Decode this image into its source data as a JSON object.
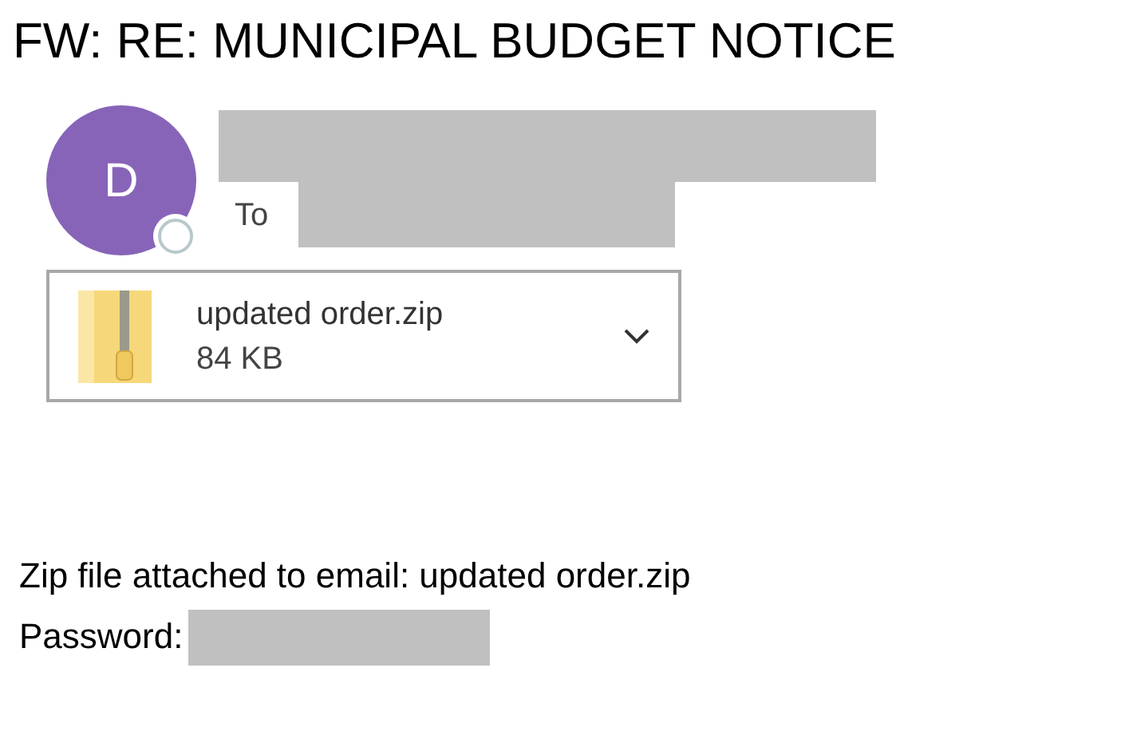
{
  "subject": "FW: RE: MUNICIPAL BUDGET NOTICE",
  "sender": {
    "avatar_initial": "D"
  },
  "recipients_label": "To",
  "attachment": {
    "name": "updated order.zip",
    "size": "84 KB"
  },
  "body": {
    "line": "Zip file attached to email: updated order.zip",
    "password_label": "Password:"
  }
}
